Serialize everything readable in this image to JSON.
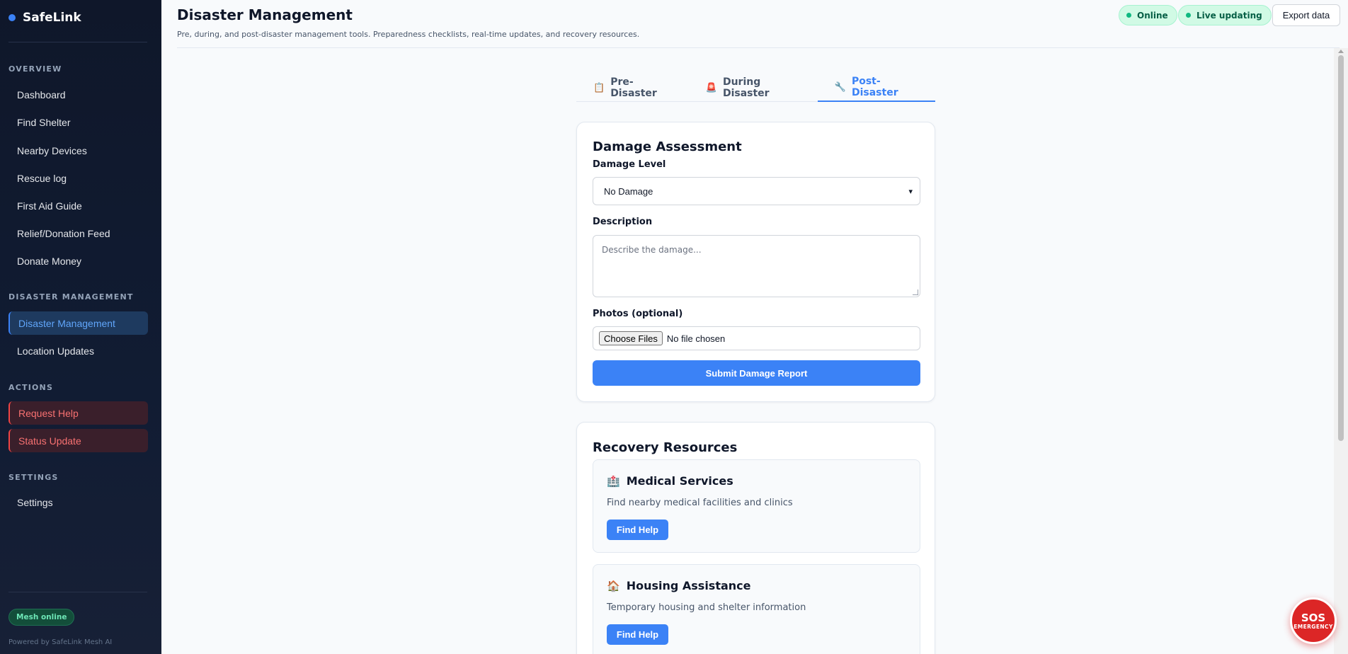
{
  "app": {
    "name": "SafeLink"
  },
  "sidebar": {
    "sections": [
      {
        "label": "OVERVIEW"
      },
      {
        "label": "DISASTER MANAGEMENT"
      },
      {
        "label": "ACTIONS"
      },
      {
        "label": "SETTINGS"
      }
    ],
    "items": [
      {
        "label": "Dashboard"
      },
      {
        "label": "Find Shelter"
      },
      {
        "label": "Nearby Devices"
      },
      {
        "label": "Rescue log"
      },
      {
        "label": "First Aid Guide"
      },
      {
        "label": "Relief/Donation Feed"
      },
      {
        "label": "Donate Money"
      },
      {
        "label": "Disaster Management"
      },
      {
        "label": "Location Updates"
      },
      {
        "label": "Request Help"
      },
      {
        "label": "Status Update"
      },
      {
        "label": "Settings"
      }
    ],
    "mesh_status": "Mesh online",
    "powered_by": "Powered by SafeLink Mesh AI"
  },
  "header": {
    "title": "Disaster Management",
    "subtitle": "Pre, during, and post-disaster management tools. Preparedness checklists, real-time updates, and recovery resources.",
    "status_online": "Online",
    "status_live": "Live updating",
    "export_label": "Export data"
  },
  "tabs": [
    {
      "icon": "📋",
      "label": "Pre-Disaster"
    },
    {
      "icon": "🚨",
      "label": "During Disaster"
    },
    {
      "icon": "🔧",
      "label": "Post-Disaster"
    }
  ],
  "damage_assessment": {
    "title": "Damage Assessment",
    "damage_level_label": "Damage Level",
    "damage_level_value": "No Damage",
    "description_label": "Description",
    "description_placeholder": "Describe the damage...",
    "photos_label": "Photos (optional)",
    "choose_files_label": "Choose Files",
    "no_file_text": "No file chosen",
    "submit_label": "Submit Damage Report"
  },
  "recovery": {
    "title": "Recovery Resources",
    "resources": [
      {
        "icon": "🏥",
        "title": "Medical Services",
        "description": "Find nearby medical facilities and clinics",
        "button": "Find Help"
      },
      {
        "icon": "🏠",
        "title": "Housing Assistance",
        "description": "Temporary housing and shelter information",
        "button": "Find Help"
      }
    ]
  },
  "sos": {
    "main": "SOS",
    "sub": "EMERGENCY"
  },
  "colors": {
    "accent": "#3b82f6",
    "danger": "#dc2626",
    "success": "#10b981",
    "sidebar_bg": "#0f172a"
  }
}
